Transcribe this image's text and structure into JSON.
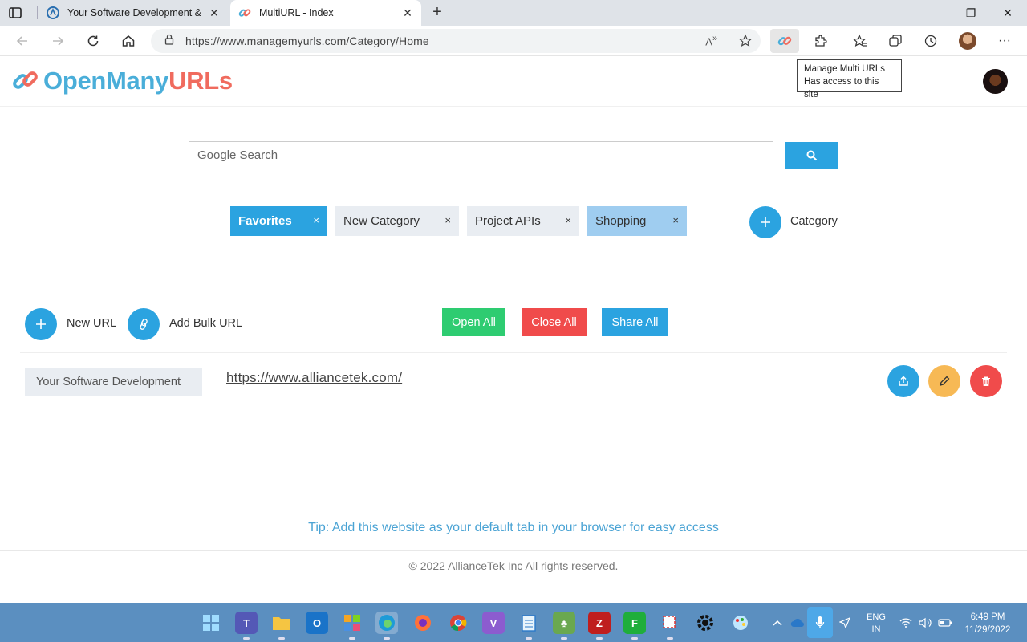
{
  "browser": {
    "tabs": [
      {
        "title": "Your Software Development & Sy",
        "active": false
      },
      {
        "title": "MultiURL - Index",
        "active": true
      }
    ],
    "new_tab": "+",
    "url": "https://www.managemyurls.com/Category/Home",
    "window_controls": {
      "minimize": "—",
      "maximize": "❐",
      "close": "✕"
    },
    "more": "···"
  },
  "extension_tooltip": {
    "line1": "Manage Multi URLs",
    "line2": "Has access to this site"
  },
  "site": {
    "logo_part1": "OpenMany",
    "logo_part2": "URLs",
    "search_placeholder": "Google Search",
    "categories": [
      {
        "name": "Favorites",
        "close": "×"
      },
      {
        "name": "New Category",
        "close": "×"
      },
      {
        "name": "Project APIs",
        "close": "×"
      },
      {
        "name": "Shopping",
        "close": "×"
      }
    ],
    "add_category_label": "Category",
    "new_url_label": "New URL",
    "add_bulk_url_label": "Add Bulk URL",
    "open_all": "Open All",
    "close_all": "Close All",
    "share_all": "Share All",
    "urls": [
      {
        "label": "Your Software Development",
        "link": "https://www.alliancetek.com/"
      }
    ],
    "tip": "Tip: Add this website as your default tab in your browser for easy access",
    "copyright": "© 2022 AllianceTek Inc All rights reserved."
  },
  "colors": {
    "primary": "#2ba3e0",
    "success": "#2ecc71",
    "danger": "#f04b4b",
    "warning": "#f7b955",
    "logo_blue": "#4aaed9",
    "logo_red": "#f06b5e"
  },
  "taskbar": {
    "apps": [
      "windows-start",
      "teams",
      "file-explorer",
      "outlook",
      "app-grid",
      "edge",
      "firefox",
      "chrome",
      "visual-studio",
      "notepad",
      "game",
      "filezilla",
      "app-f",
      "snipping-tool",
      "settings",
      "paint"
    ],
    "language_line1": "ENG",
    "language_line2": "IN",
    "time": "6:49 PM",
    "date": "11/29/2022"
  }
}
